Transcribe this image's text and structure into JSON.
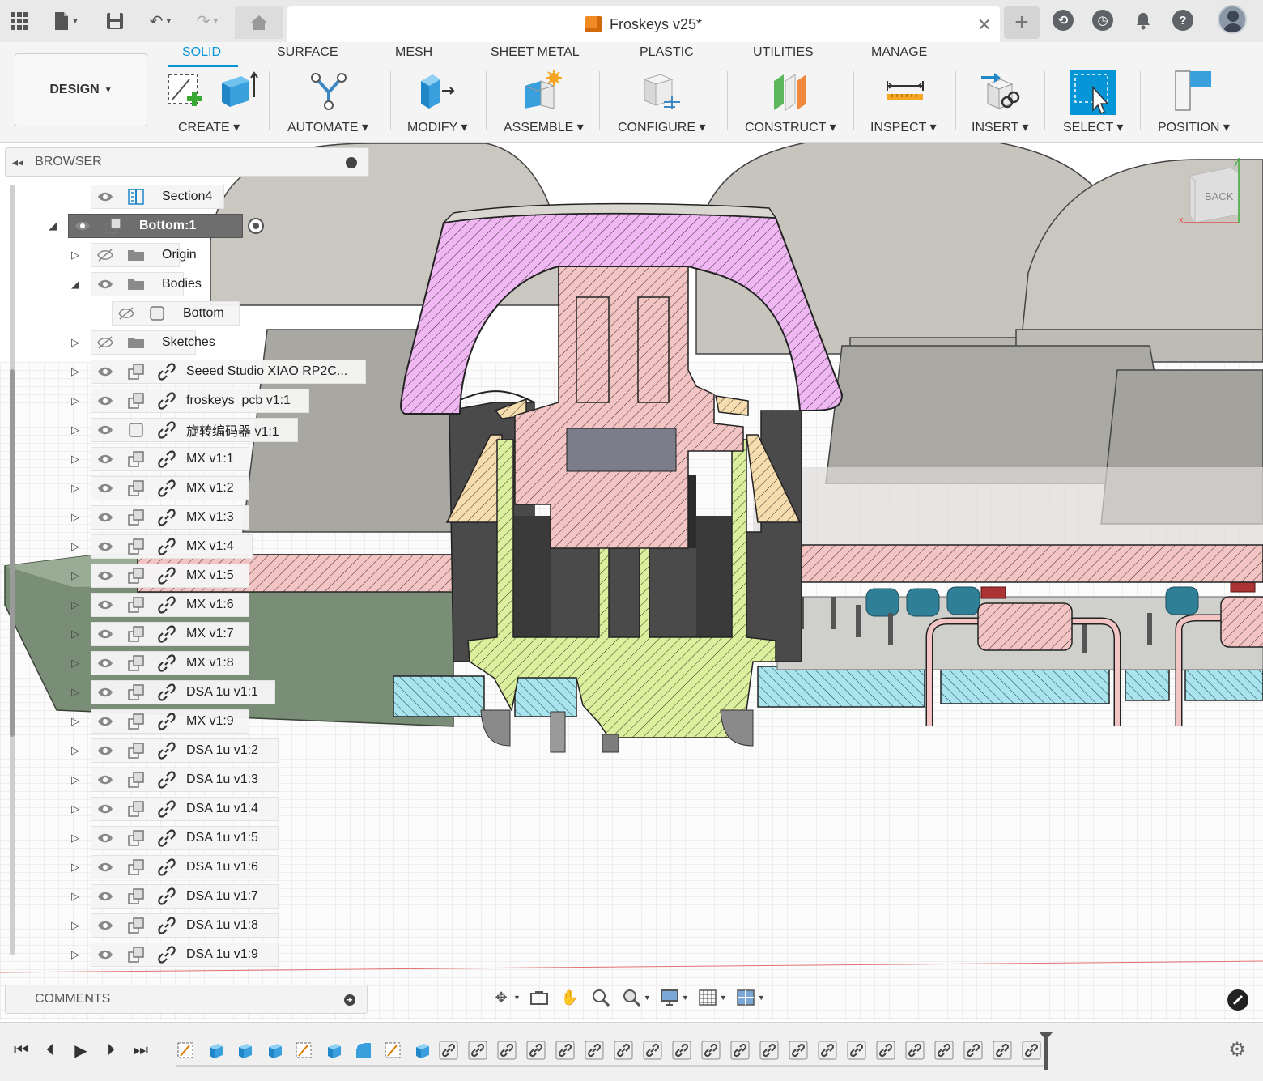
{
  "window": {
    "doc_title": "Froskeys v25*"
  },
  "toolbar": {
    "workspace": "DESIGN",
    "tabs": [
      "SOLID",
      "SURFACE",
      "MESH",
      "SHEET METAL",
      "PLASTIC",
      "UTILITIES",
      "MANAGE"
    ],
    "active_tab": "SOLID",
    "groups": [
      "CREATE",
      "AUTOMATE",
      "MODIFY",
      "ASSEMBLE",
      "CONFIGURE",
      "CONSTRUCT",
      "INSPECT",
      "INSERT",
      "SELECT",
      "POSITION"
    ]
  },
  "browser": {
    "title": "BROWSER",
    "items": [
      {
        "label": "Section4",
        "icon": "section-icon",
        "visible": true
      },
      {
        "label": "Bottom:1",
        "icon": "component-icon",
        "visible": true,
        "active": true
      },
      {
        "label": "Origin",
        "icon": "folder-icon",
        "visible": false
      },
      {
        "label": "Bodies",
        "icon": "folder-icon",
        "visible": true
      },
      {
        "label": "Bottom",
        "icon": "body-icon",
        "visible": false
      },
      {
        "label": "Sketches",
        "icon": "folder-icon",
        "visible": false
      },
      {
        "label": "Seeed Studio XIAO RP2C...",
        "icon": "component-icon",
        "visible": true,
        "linked": true
      },
      {
        "label": "froskeys_pcb v1:1",
        "icon": "component-icon",
        "visible": true,
        "linked": true
      },
      {
        "label": "旋转编码器 v1:1",
        "icon": "body-icon",
        "visible": true,
        "linked": true
      },
      {
        "label": "MX v1:1",
        "icon": "component-icon",
        "visible": true,
        "linked": true
      },
      {
        "label": "MX v1:2",
        "icon": "component-icon",
        "visible": true,
        "linked": true
      },
      {
        "label": "MX v1:3",
        "icon": "component-icon",
        "visible": true,
        "linked": true
      },
      {
        "label": "MX v1:4",
        "icon": "component-icon",
        "visible": true,
        "linked": true
      },
      {
        "label": "MX v1:5",
        "icon": "component-icon",
        "visible": true,
        "linked": true
      },
      {
        "label": "MX v1:6",
        "icon": "component-icon",
        "visible": true,
        "linked": true
      },
      {
        "label": "MX v1:7",
        "icon": "component-icon",
        "visible": true,
        "linked": true
      },
      {
        "label": "MX v1:8",
        "icon": "component-icon",
        "visible": true,
        "linked": true
      },
      {
        "label": "DSA 1u v1:1",
        "icon": "component-icon",
        "visible": true,
        "linked": true
      },
      {
        "label": "MX v1:9",
        "icon": "component-icon",
        "visible": true,
        "linked": true
      },
      {
        "label": "DSA 1u v1:2",
        "icon": "component-icon",
        "visible": true,
        "linked": true
      },
      {
        "label": "DSA 1u v1:3",
        "icon": "component-icon",
        "visible": true,
        "linked": true
      },
      {
        "label": "DSA 1u v1:4",
        "icon": "component-icon",
        "visible": true,
        "linked": true
      },
      {
        "label": "DSA 1u v1:5",
        "icon": "component-icon",
        "visible": true,
        "linked": true
      },
      {
        "label": "DSA 1u v1:6",
        "icon": "component-icon",
        "visible": true,
        "linked": true
      },
      {
        "label": "DSA 1u v1:7",
        "icon": "component-icon",
        "visible": true,
        "linked": true
      },
      {
        "label": "DSA 1u v1:8",
        "icon": "component-icon",
        "visible": true,
        "linked": true
      },
      {
        "label": "DSA 1u v1:9",
        "icon": "component-icon",
        "visible": true,
        "linked": true
      }
    ]
  },
  "viewcube": {
    "face": "BACK"
  },
  "comments": {
    "title": "COMMENTS"
  },
  "timeline": {
    "features": [
      "sketch",
      "extrude",
      "extrude",
      "extrude",
      "sketch",
      "extrude",
      "fillet",
      "sketch",
      "extrude",
      "joint",
      "joint",
      "joint",
      "joint",
      "joint",
      "joint",
      "joint",
      "joint",
      "joint",
      "joint",
      "joint",
      "joint",
      "joint",
      "joint",
      "joint",
      "joint",
      "joint",
      "joint",
      "joint",
      "joint",
      "joint"
    ]
  },
  "colors": {
    "accent": "#0696d7",
    "section_pink": "#f3c4c4",
    "section_magenta": "#f0b3f0",
    "section_green": "#dcef9e",
    "section_cyan": "#a8e3ee",
    "section_orange": "#f6ddb0",
    "keycap_gray": "#c9c7c0"
  }
}
